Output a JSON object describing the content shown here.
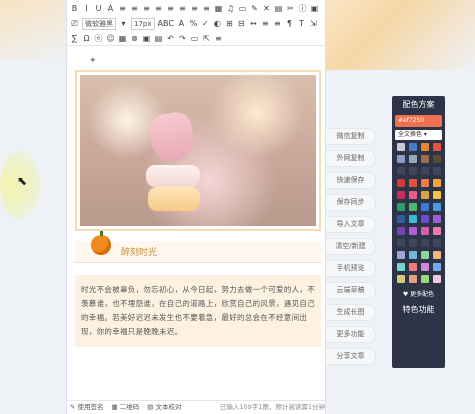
{
  "toolbar": {
    "row1": [
      "B",
      "I",
      "U",
      "A",
      "≡",
      "≡",
      "≡",
      "≡",
      "≡",
      "≡",
      "≡",
      "≡",
      "▦",
      "♫",
      "▭",
      "✎",
      "✕",
      "▤",
      "✂",
      "ⓘ",
      "▣"
    ],
    "font_family": "微软雅黑",
    "font_size": "17px",
    "row2_extra": [
      "ABC",
      "A",
      "%",
      "✓",
      "◐",
      "⊞",
      "⊟",
      "↔",
      "≡",
      "≡",
      "¶",
      "T",
      "⇲",
      "⇱",
      "A"
    ],
    "row3": [
      "∑",
      "Ω",
      "ⓔ",
      "☺",
      "▦",
      "⊗",
      "▣",
      "▤",
      "↶",
      "↷",
      "▭",
      "⇱",
      "≡"
    ]
  },
  "content": {
    "caption": "醉刻时光",
    "paragraph": "时光不会被辜负，勿忘初心，从今日起，努力去做一个可爱的人，不羡慕谁，也不埋怨谁，在自己的道路上，欣赏自己的风景，遇见自己的幸福。若美好迟迟未发生也不要着急，最好的总会在不经意间出现，你的幸福只是晚晚未迟。"
  },
  "statusbar": {
    "sign": "使用签名",
    "qrcode": "二维码",
    "proofread": "文本校对",
    "count": "已输入109字1图，预计阅读需1分钟"
  },
  "sidebar": {
    "items": [
      "微信复制",
      "外网复制",
      "快速保存",
      "保存同步",
      "导入文章",
      "清空/新建",
      "手机预览",
      "云端草稿",
      "生成长图",
      "更多功能",
      "分享文章"
    ]
  },
  "scheme": {
    "title": "配色方案",
    "current_color": "#ef7250",
    "scope": "全文换色",
    "more": "♥ 更多配色",
    "feature": "特色功能",
    "swatches": [
      "#c7ccd6",
      "#4a7bc9",
      "#e8832f",
      "#e0543e",
      "#8b9cc6",
      "#9aa7b6",
      "#9a6f4a",
      "#5a4a3a",
      "#3d4759",
      "#3d4759",
      "#3d4759",
      "#3d4759",
      "#d43a3a",
      "#e0543e",
      "#f07a4a",
      "#f2a43c",
      "#c92c5a",
      "#e85a8a",
      "#d9a441",
      "#f5c342",
      "#2d9d6a",
      "#4cb86a",
      "#3a7ad6",
      "#4a9be0",
      "#2c5fa8",
      "#3dbbd6",
      "#6a4fc9",
      "#9a5fd6",
      "#7a3fb6",
      "#b05fd6",
      "#d65fa8",
      "#f07ab0",
      "#3d4759",
      "#3d4759",
      "#3d4759",
      "#3d4759",
      "#9fa4d6",
      "#6fb6d9",
      "#8bd69a",
      "#f2b87a",
      "#7ad6c9",
      "#f07a7a",
      "#c98bd6",
      "#7aa6f0",
      "#d6c97a",
      "#e8a07a",
      "#9ad67a",
      "#f0c9e0"
    ]
  }
}
